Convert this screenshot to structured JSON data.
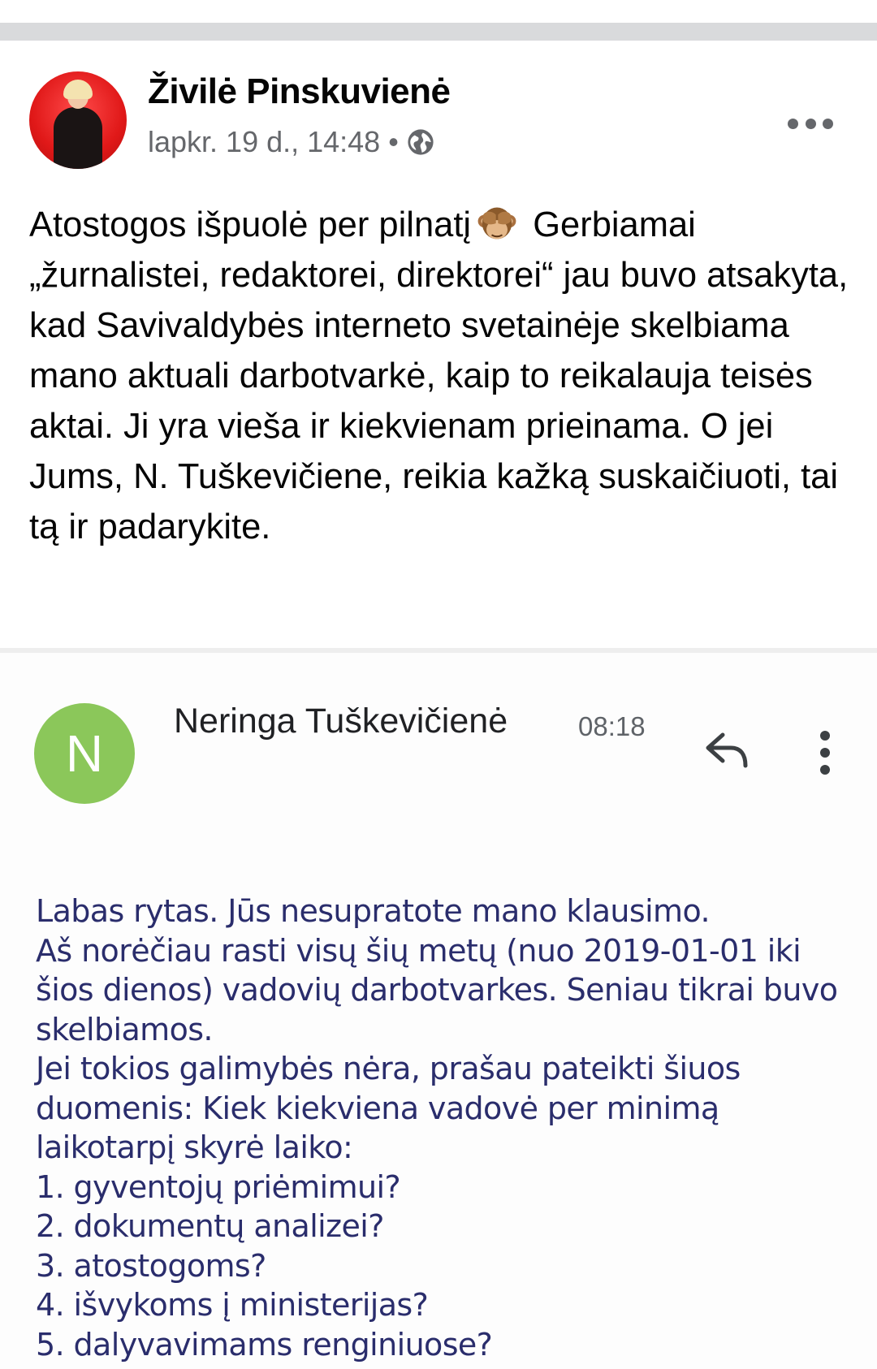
{
  "post": {
    "author": "Živilė Pinskuvienė",
    "date": "lapkr. 19 d., 14:48",
    "separator": "•",
    "audience_icon": "globe-icon",
    "more_icon": "more-options-icon",
    "text_before_emoji": "Atostogos išpuolė per pilnatį",
    "emoji": "see-no-evil-monkey-icon",
    "text_after_emoji": "Gerbiamai „žurnalistei, redaktorei, direktorei“ jau buvo atsakyta, kad Savivaldybės interneto svetainėje skelbiama mano aktuali darbotvarkė, kaip to reikalauja teisės aktai. Ji yra vieša ir kiekvienam prieinama. O jei Jums, N. Tuškevičiene, reikia kažką suskaičiuoti, tai tą ir padarykite."
  },
  "email": {
    "avatar_letter": "N",
    "sender": "Neringa Tuškevičienė",
    "time": "08:18",
    "reply_icon": "reply-icon",
    "more_icon": "kebab-menu-icon",
    "body_lines": [
      "Labas rytas. Jūs nesupratote mano klausimo.",
      "Aš norėčiau rasti visų šių metų (nuo 2019-01-01 iki",
      "šios dienos) vadovių darbotvarkes. Seniau tikrai buvo",
      "skelbiamos.",
      "Jei tokios galimybės nėra, prašau pateikti šiuos",
      "duomenis: Kiek kiekviena vadovė per minimą",
      "laikotarpį skyrė laiko:",
      "1. gyventojų priėmimui?",
      "2. dokumentų analizei?",
      "3. atostogoms?",
      "4. išvykoms į ministerijas?",
      "5. dalyvavimams renginiuose?"
    ]
  },
  "colors": {
    "name_text": "#050505",
    "meta_text": "#65676b",
    "email_avatar_bg": "#8bc75a",
    "email_body_text": "#2a2d6c"
  }
}
